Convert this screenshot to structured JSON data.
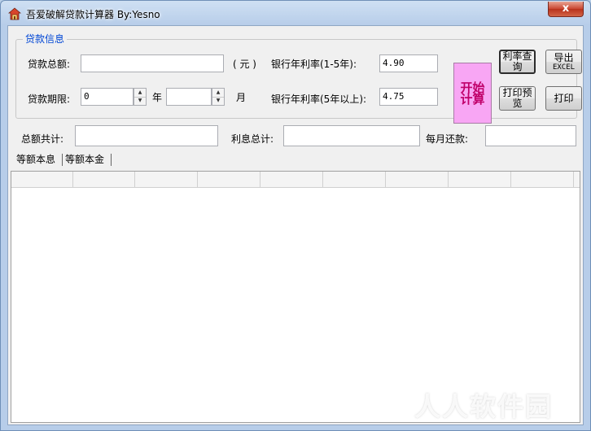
{
  "window": {
    "title": "吾爱破解贷款计算器 By:Yesno",
    "close_label": "x",
    "app_icon": "house-icon"
  },
  "loan_info": {
    "group_label": "贷款信息",
    "total_label": "贷款总额:",
    "total_value": "",
    "unit_label": "( 元 )",
    "term_label": "贷款期限:",
    "term_years_value": "0",
    "years_label": "年",
    "term_months_value": "",
    "months_label": "月",
    "rate_short_label": "银行年利率(1-5年):",
    "rate_short_value": "4.90",
    "rate_long_label": "银行年利率(5年以上):",
    "rate_long_value": "4.75"
  },
  "buttons": {
    "start": "开始计算",
    "rate_query": "利率查询",
    "export_excel_line1": "导出",
    "export_excel_line2": "EXCEL",
    "print_preview": "打印预览",
    "print": "打印"
  },
  "summary": {
    "total_label": "总额共计:",
    "total_value": "",
    "interest_label": "利息总计:",
    "interest_value": "",
    "monthly_label": "每月还款:",
    "monthly_value": ""
  },
  "tabs": [
    {
      "label": "等额本息",
      "active": true
    },
    {
      "label": "等额本金",
      "active": false
    }
  ],
  "grid": {
    "columns": [
      "",
      "",
      "",
      "",
      "",
      "",
      "",
      "",
      ""
    ]
  },
  "watermark": "人人软件园"
}
